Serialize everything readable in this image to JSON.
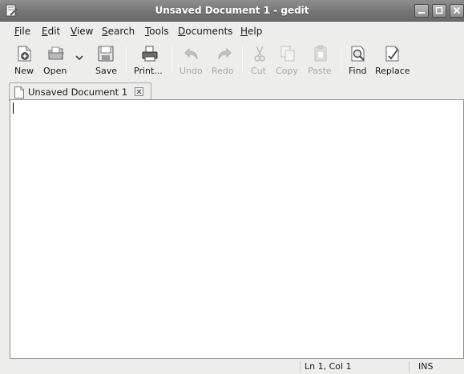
{
  "window": {
    "title": "Unsaved Document 1 - gedit"
  },
  "menubar": {
    "items": [
      {
        "mnemonic": "F",
        "rest": "ile"
      },
      {
        "mnemonic": "E",
        "rest": "dit"
      },
      {
        "mnemonic": "V",
        "rest": "iew"
      },
      {
        "mnemonic": "S",
        "rest": "earch"
      },
      {
        "mnemonic": "T",
        "rest": "ools"
      },
      {
        "mnemonic": "D",
        "rest": "ocuments"
      },
      {
        "mnemonic": "H",
        "rest": "elp"
      }
    ]
  },
  "toolbar": {
    "new_label": "New",
    "open_label": "Open",
    "save_label": "Save",
    "print_label": "Print...",
    "undo_label": "Undo",
    "redo_label": "Redo",
    "cut_label": "Cut",
    "copy_label": "Copy",
    "paste_label": "Paste",
    "find_label": "Find",
    "replace_label": "Replace"
  },
  "tabs": [
    {
      "label": "Unsaved Document 1"
    }
  ],
  "editor": {
    "content": ""
  },
  "statusbar": {
    "position": "Ln 1, Col 1",
    "mode": "INS"
  },
  "colors": {
    "titlebar": "#777777",
    "window_bg": "#ededeb",
    "editor_bg": "#ffffff",
    "disabled_text": "#a8a8a8"
  }
}
